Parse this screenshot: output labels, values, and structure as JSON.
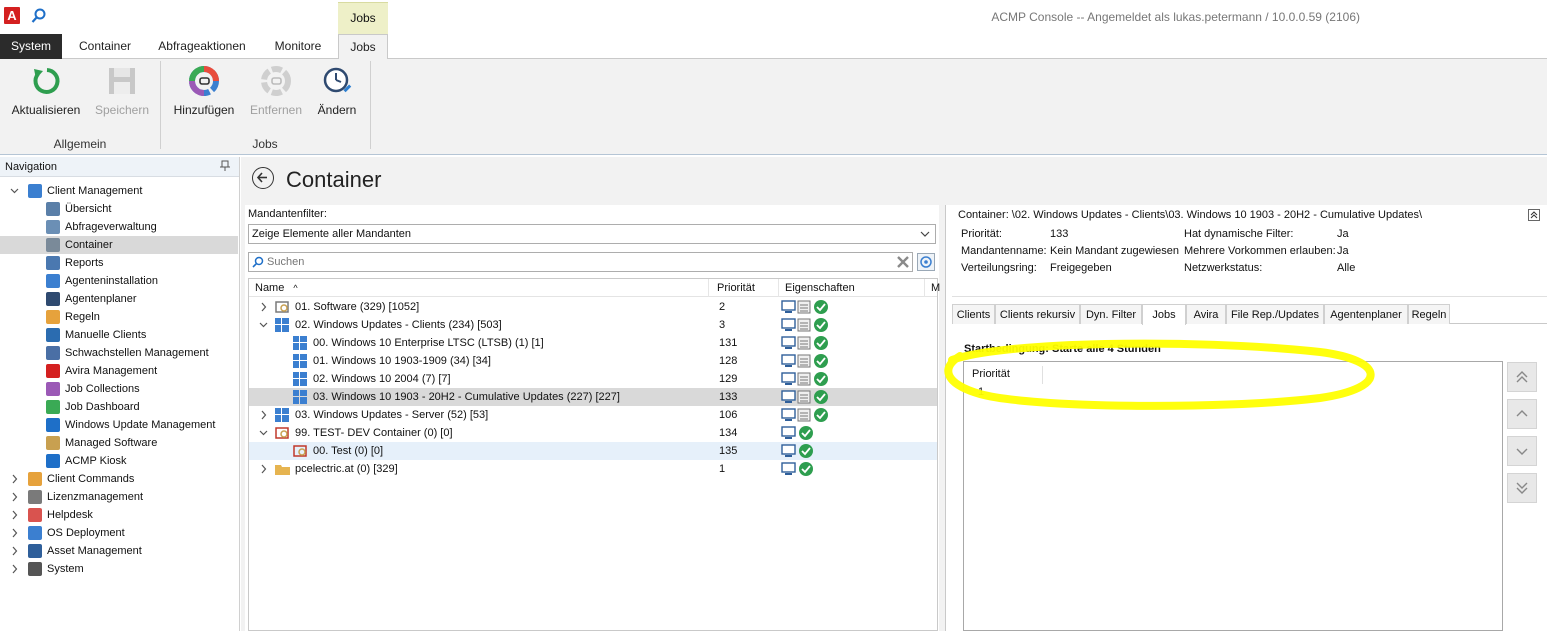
{
  "app": {
    "logo_letter": "A",
    "window_title": "ACMP Console -- Angemeldet als lukas.petermann / 10.0.0.59 (2106)",
    "context_tab": "Jobs"
  },
  "ribbon_tabs": [
    "System",
    "Container",
    "Abfrageaktionen",
    "Monitore",
    "Jobs"
  ],
  "ribbon": {
    "group_general_label": "Allgemein",
    "group_jobs_label": "Jobs",
    "refresh": "Aktualisieren",
    "save": "Speichern",
    "add": "Hinzufügen",
    "remove": "Entfernen",
    "change": "Ändern"
  },
  "nav": {
    "header": "Navigation",
    "items": [
      "Client Management",
      "Übersicht",
      "Abfrageverwaltung",
      "Container",
      "Reports",
      "Agenteninstallation",
      "Agentenplaner",
      "Regeln",
      "Manuelle Clients",
      "Schwachstellen Management",
      "Avira Management",
      "Job Collections",
      "Job Dashboard",
      "Windows Update Management",
      "Managed Software",
      "ACMP Kiosk",
      "Client Commands",
      "Lizenzmanagement",
      "Helpdesk",
      "OS Deployment",
      "Asset Management",
      "System"
    ]
  },
  "page": {
    "title": "Container"
  },
  "filter": {
    "label": "Mandantenfilter:",
    "value": "Zeige Elemente aller Mandanten",
    "search_placeholder": "Suchen"
  },
  "tree": {
    "columns": [
      "Name",
      "Priorität",
      "Eigenschaften",
      "M"
    ],
    "rows": [
      {
        "name": "01. Software (329) [1052]",
        "priority": "2"
      },
      {
        "name": "02. Windows Updates - Clients (234) [503]",
        "priority": "3"
      },
      {
        "name": "00. Windows 10 Enterprise LTSC (LTSB) (1) [1]",
        "priority": "131"
      },
      {
        "name": "01. Windows 10 1903-1909 (34) [34]",
        "priority": "128"
      },
      {
        "name": "02. Windows 10 2004 (7) [7]",
        "priority": "129"
      },
      {
        "name": "03. Windows 10 1903 - 20H2 - Cumulative Updates (227) [227]",
        "priority": "133"
      },
      {
        "name": "03. Windows Updates - Server (52) [53]",
        "priority": "106"
      },
      {
        "name": "99. TEST- DEV Container (0) [0]",
        "priority": "134"
      },
      {
        "name": "00. Test (0) [0]",
        "priority": "135"
      },
      {
        "name": "pcelectric.at (0) [329]",
        "priority": "1"
      }
    ]
  },
  "details": {
    "path": "Container: \\02. Windows Updates - Clients\\03. Windows 10 1903 - 20H2 - Cumulative Updates\\",
    "prio_label": "Priorität:",
    "prio_value": "133",
    "mandant_label": "Mandantenname:",
    "mandant_value": "Kein Mandant zugewiesen",
    "ring_label": "Verteilungsring:",
    "ring_value": "Freigegeben",
    "dynfilter_label": "Hat dynamische Filter:",
    "dynfilter_value": "Ja",
    "multi_label": "Mehrere Vorkommen erlauben:",
    "multi_value": "Ja",
    "netstatus_label": "Netzwerkstatus:",
    "netstatus_value": "Alle"
  },
  "detail_tabs": [
    "Clients",
    "Clients rekursiv",
    "Dyn. Filter",
    "Jobs",
    "Avira",
    "File Rep./Updates",
    "Agentenplaner",
    "Regeln"
  ],
  "jobs_panel": {
    "start_condition": "Startbedingung: Starte alle 4 Stunden",
    "column": "Priorität",
    "value": "1"
  },
  "colors": {
    "highlight": "#ffff00",
    "accent_green": "#2e9e4f",
    "selection": "#d9d9d9"
  }
}
